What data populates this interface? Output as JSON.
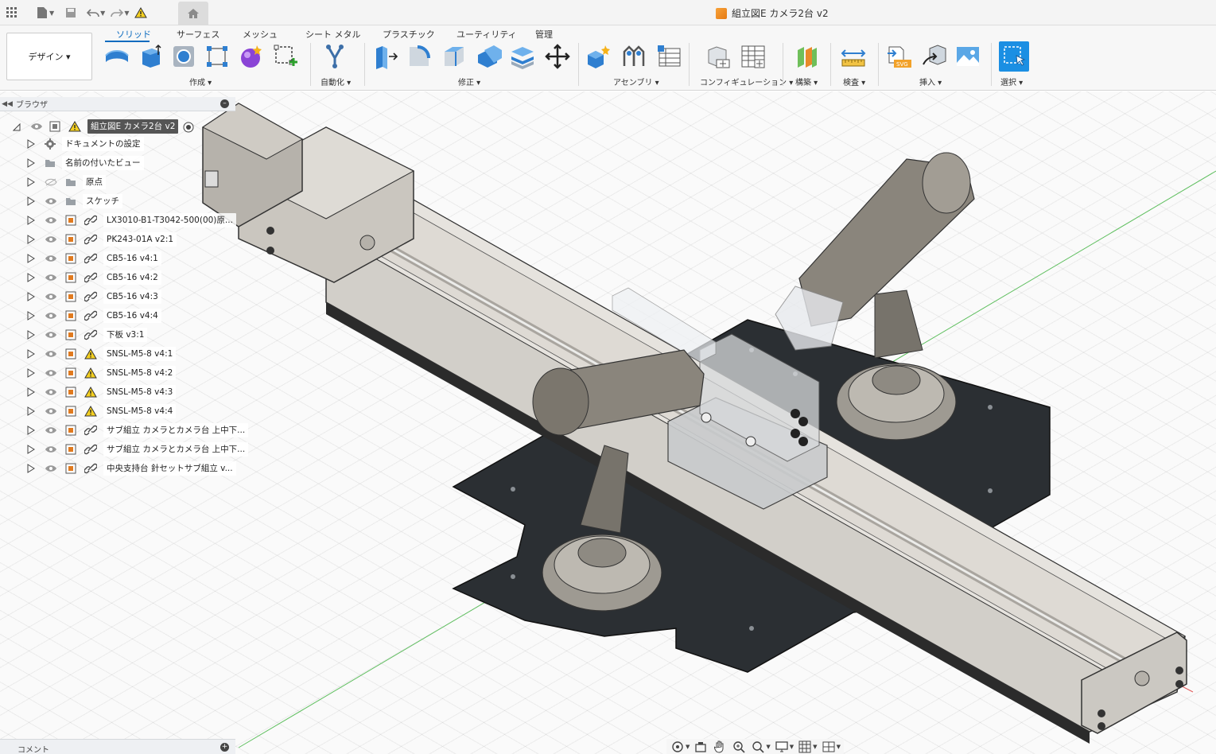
{
  "titlebar": {
    "doc_title": "組立図E カメラ2台 v2"
  },
  "toolbar": {
    "workspace": "デザイン ▾",
    "tabs": [
      "ソリッド",
      "サーフェス",
      "メッシュ",
      "シート メタル",
      "プラスチック",
      "ユーティリティ",
      "管理"
    ],
    "groups": {
      "create": "作成 ▾",
      "automate": "自動化 ▾",
      "modify": "修正 ▾",
      "assemble": "アセンブリ ▾",
      "configure": "コンフィギュレーション ▾",
      "construct": "構築 ▾",
      "inspect": "検査 ▾",
      "insert": "挿入 ▾",
      "select": "選択 ▾"
    }
  },
  "browser": {
    "title": "ブラウザ",
    "root": "組立図E カメラ2台 v2",
    "items": [
      {
        "label": "ドキュメントの設定",
        "icon": "gear-icon"
      },
      {
        "label": "名前の付いたビュー",
        "icon": "folder-icon"
      },
      {
        "label": "原点",
        "icon": "folder-icon"
      },
      {
        "label": "スケッチ",
        "icon": "folder-icon"
      },
      {
        "label": "LX3010-B1-T3042-500(00)原...",
        "icon": "component-icon"
      },
      {
        "label": "PK243-01A v2:1",
        "icon": "component-icon"
      },
      {
        "label": "CB5-16 v4:1",
        "icon": "component-icon"
      },
      {
        "label": "CB5-16 v4:2",
        "icon": "component-icon"
      },
      {
        "label": "CB5-16 v4:3",
        "icon": "component-icon"
      },
      {
        "label": "CB5-16 v4:4",
        "icon": "component-icon"
      },
      {
        "label": "下板 v3:1",
        "icon": "component-icon"
      },
      {
        "label": "SNSL-M5-8 v4:1",
        "icon": "warning-icon"
      },
      {
        "label": "SNSL-M5-8 v4:2",
        "icon": "warning-icon"
      },
      {
        "label": "SNSL-M5-8 v4:3",
        "icon": "warning-icon"
      },
      {
        "label": "SNSL-M5-8 v4:4",
        "icon": "warning-icon"
      },
      {
        "label": "サブ組立 カメラとカメラ台 上中下...",
        "icon": "component-icon"
      },
      {
        "label": "サブ組立 カメラとカメラ台 上中下...",
        "icon": "component-icon"
      },
      {
        "label": "中央支持台 針セットサブ組立 v...",
        "icon": "component-icon"
      }
    ]
  },
  "comments": {
    "title": "コメント"
  },
  "colors": {
    "accent": "#0d6cbf",
    "select_blue": "#1b8fe3",
    "plate": "#2b2f33",
    "rail": "#c8c5c0"
  }
}
